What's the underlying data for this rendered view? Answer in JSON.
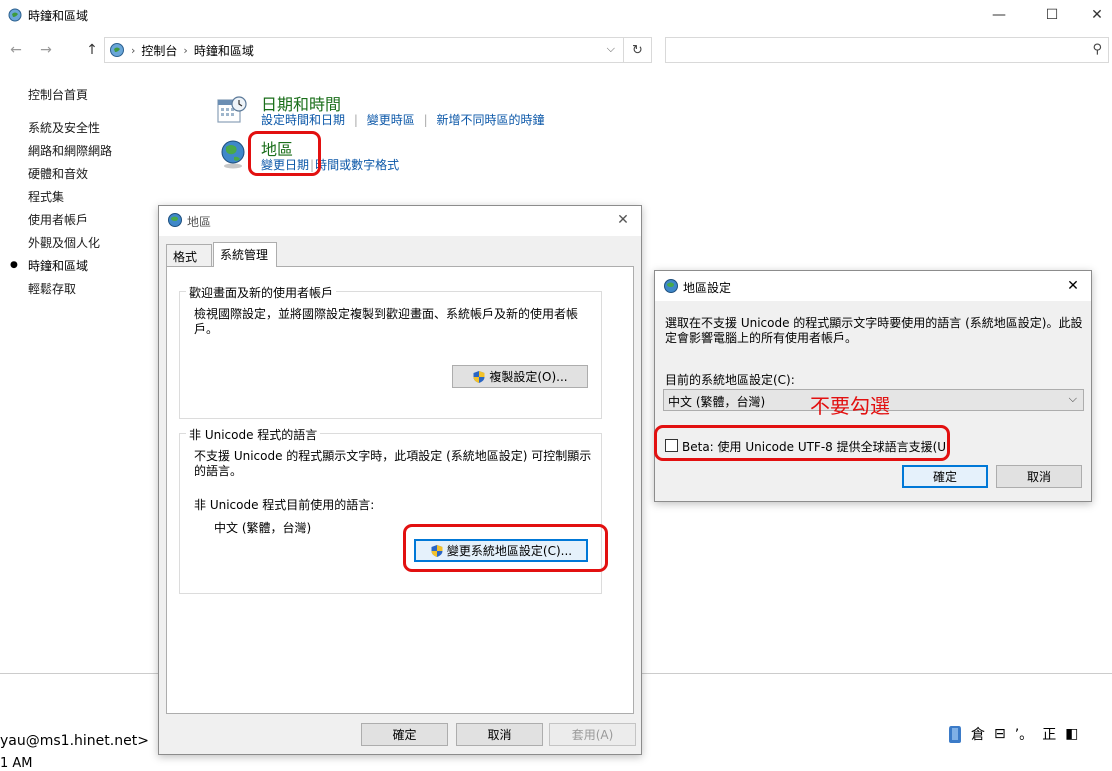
{
  "window": {
    "title": "時鐘和區域",
    "minimize_glyph": "—",
    "maximize_glyph": "☐",
    "close_glyph": "✕"
  },
  "nav": {
    "back_glyph": "←",
    "forward_glyph": "→",
    "up_glyph": "↑",
    "breadcrumb": [
      "控制台",
      "時鐘和區域"
    ],
    "separator": "›",
    "dropdown_glyph": "⌵",
    "refresh_glyph": "↻",
    "search_glyph": "⚲"
  },
  "sidebar": {
    "home": "控制台首頁",
    "items": [
      "系統及安全性",
      "網路和網際網路",
      "硬體和音效",
      "程式集",
      "使用者帳戶",
      "外觀及個人化",
      "時鐘和區域",
      "輕鬆存取"
    ],
    "active_bullet": "●"
  },
  "content": {
    "datetime": {
      "title": "日期和時間",
      "links": [
        "設定時間和日期",
        "變更時區",
        "新增不同時區的時鐘"
      ]
    },
    "region": {
      "title": "地區",
      "links": [
        "變更日期",
        "時間或數字格式"
      ]
    },
    "link_separator": "|"
  },
  "region_dialog": {
    "title": "地區",
    "close_glyph": "✕",
    "tabs": [
      "格式",
      "系統管理"
    ],
    "welcome_group": {
      "legend": "歡迎畫面及新的使用者帳戶",
      "description": "檢視國際設定，並將國際設定複製到歡迎畫面、系統帳戶及新的使用者帳戶。",
      "copy_button": "複製設定(O)..."
    },
    "nonunicode_group": {
      "legend": "非 Unicode 程式的語言",
      "description": "不支援 Unicode 的程式顯示文字時，此項設定 (系統地區設定) 可控制顯示的語言。",
      "current_label": "非 Unicode 程式目前使用的語言:",
      "current_value": "中文 (繁體，台灣)",
      "change_button": "變更系統地區設定(C)..."
    },
    "ok": "確定",
    "cancel": "取消",
    "apply": "套用(A)"
  },
  "locale_dialog": {
    "title": "地區設定",
    "close_glyph": "✕",
    "description": "選取在不支援 Unicode 的程式顯示文字時要使用的語言 (系統地區設定)。此設定會影響電腦上的所有使用者帳戶。",
    "current_label": "目前的系統地區設定(C):",
    "current_value": "中文 (繁體，台灣)",
    "select_chevron": "⌵",
    "beta_label": "Beta: 使用 Unicode UTF-8 提供全球語言支援(U)",
    "beta_checked": false,
    "ok": "確定",
    "cancel": "取消"
  },
  "annotation": {
    "text": "不要勾選",
    "color": "#e21010"
  },
  "background": {
    "email_fragment": "yau@ms1.hinet.net>",
    "time_fragment": "1 AM"
  },
  "ime_bar": {
    "items": [
      "倉",
      "⊟",
      "’。",
      "正",
      "◧"
    ]
  },
  "colors": {
    "link": "#0b57a8",
    "category_title": "#1a6e1a",
    "accent": "#0078d7"
  }
}
